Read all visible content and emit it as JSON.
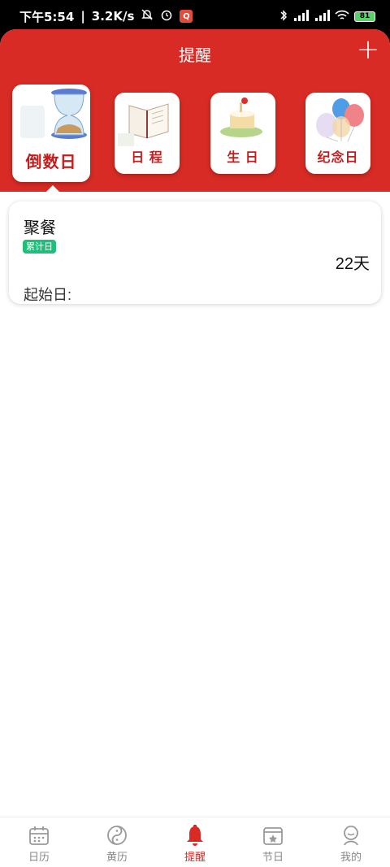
{
  "status_bar": {
    "time": "下午5:54",
    "speed": "3.2K/s",
    "battery": "81"
  },
  "header": {
    "title": "提醒",
    "add_label": "+"
  },
  "categories": [
    {
      "label": "倒数日",
      "active": true
    },
    {
      "label": "日 程",
      "active": false
    },
    {
      "label": "生 日",
      "active": false
    },
    {
      "label": "纪念日",
      "active": false
    }
  ],
  "card": {
    "title": "聚餐",
    "badge": "累计日",
    "days": "22天",
    "start_label": "起始日:"
  },
  "bottom_nav": [
    {
      "label": "日历",
      "icon": "calendar-icon"
    },
    {
      "label": "黄历",
      "icon": "yinyang-icon"
    },
    {
      "label": "提醒",
      "icon": "bell-icon",
      "active": true
    },
    {
      "label": "节日",
      "icon": "festival-icon"
    },
    {
      "label": "我的",
      "icon": "profile-icon"
    }
  ],
  "colors": {
    "brand_red": "#d82b25",
    "badge_green": "#1fbe7b"
  }
}
